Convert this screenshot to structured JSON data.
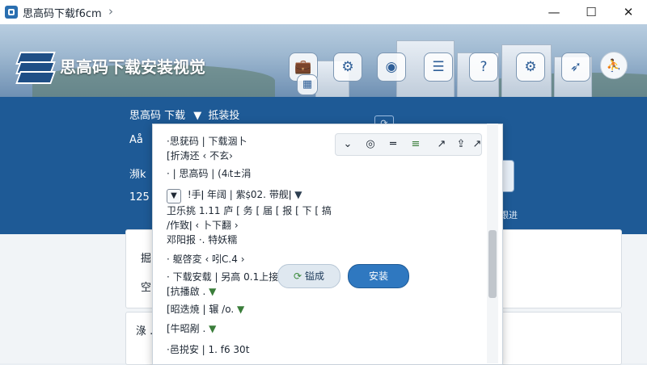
{
  "window": {
    "title": "思高码下载f6cm",
    "nav": "›",
    "controls": {
      "minimize": "—",
      "maximize": "☐",
      "close": "✕"
    }
  },
  "hero": {
    "brand": "思高码下载安装视觉",
    "icons": [
      "briefcase-icon",
      "gear-badge-icon",
      "photo-icon",
      "document-icon",
      "help-icon",
      "settings-cog-icon",
      "rocket-icon"
    ],
    "icon_glyphs": [
      "💼",
      "⚙",
      "◉",
      "☰",
      "?",
      "⚙",
      "➶"
    ],
    "small_tile_glyph": "▦",
    "avatar_label": "⛹"
  },
  "band": {
    "breadcrumb": "思高码  下载",
    "filter_label": "抵装投",
    "left_texts": [
      "Aå",
      "瀕k",
      "125"
    ],
    "refresh_glyph": "⟳",
    "right_tile_label": "跟进"
  },
  "cards": {
    "label_a1": "掘",
    "label_a2": "空",
    "label_b": "淥 ."
  },
  "panel": {
    "toolbar": [
      "⌄",
      "◎",
      "═",
      "≡",
      "↗",
      "⇪",
      "↗"
    ],
    "rows": [
      {
        "text": "·思莸码 | 下载涸卜"
      },
      {
        "text": "[折涛还 ‹ 不玄›"
      },
      {
        "text": "· | 思高码 | (4ᵢt±涓"
      },
      {
        "text": "!手ǀ 年阔 | 紫ṩ02. 带舰ǀ"
      },
      {
        "text": "卫乐挑 1.11 庐 [ 务 [ 届 [ 报 [ 下 [ 搞"
      },
      {
        "text": "/作致ǀ ‹ 卜下翻 ›"
      },
      {
        "text": "邓阳报 ·. 特妖糯"
      },
      {
        "text": "· 躯啓変 ‹ 吲C.4 ›"
      },
      {
        "text": "· 下载安载 | 另高 0.1上接"
      },
      {
        "text": "[抗播啟 ."
      },
      {
        "text": "[昭迭焼 | 辗 /o."
      },
      {
        "text": "[牛昭剐 ."
      },
      {
        "text": "·邑捝安 | 1. f6 30t"
      }
    ],
    "continue_label": "镒成",
    "install_label": "安装"
  },
  "colors": {
    "accent": "#1e5a96",
    "primary_button": "#2f78c0",
    "secondary_button": "#dfe8f0"
  }
}
